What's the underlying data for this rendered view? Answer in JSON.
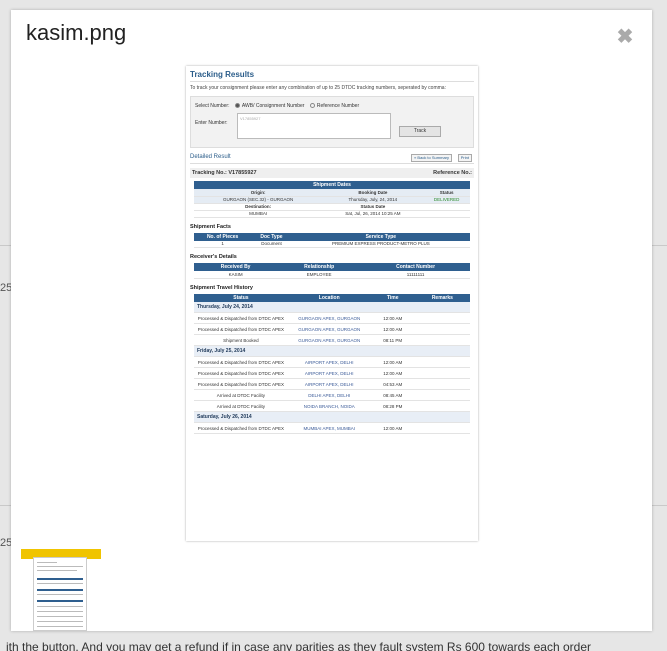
{
  "background": {
    "row_num_1": "25",
    "row_num_2": "25",
    "bottom_text": "ith the button. And you may get a refund if in case any parities as they fault system Rs 600 towards each order"
  },
  "lightbox": {
    "title": "kasim.png",
    "close_glyph": "✖"
  },
  "image": {
    "title": "Tracking Results",
    "description": "To track your consignment please enter any combination of up to 25 DTDC tracking numbers, seperated by comma:",
    "select_label": "Select Number:",
    "radio_awb": "AWB/ Consignment Number",
    "radio_ref": "Reference Number",
    "enter_label": "Enter Number:",
    "enter_value": "V17855927",
    "track_button": "Track",
    "detailed_result": "Detailed Result",
    "back_button": "« Back to Summary",
    "print_button": "Print",
    "tracking_no": "Tracking No.: V17855927",
    "reference_no": "Reference No.:",
    "shipment_dates_header": "Shipment Dates",
    "origin_label": "Origin:",
    "origin_value": "GURGAON (SEC.32) - GURGAON",
    "booking_label": "Booking Date",
    "booking_value": "Thursday, July, 24, 2014",
    "status_label": "Status",
    "status_value": "DELIVERED",
    "destination_label": "Destination:",
    "destination_value": "MUMBAI",
    "status_date_label": "Status Date",
    "status_date_value": "Sat, Jul, 26, 2014 10:25 AM",
    "facts_title": "Shipment Facts",
    "facts_headers": [
      "No. of Pieces",
      "Doc Type",
      "Service Type"
    ],
    "facts_row": [
      "1",
      "Document",
      "PREMIUM EXPRESS PRODUCT-METRO PLUS"
    ],
    "receiver_title": "Receiver's Details",
    "receiver_headers": [
      "Received By",
      "Relationship",
      "Contact Number"
    ],
    "receiver_row": [
      "KASIM",
      "EMPLOYEE",
      "11111111"
    ],
    "history_title": "Shipment Travel History",
    "history_headers": [
      "Status",
      "Location",
      "Time",
      "Remarks"
    ],
    "day1": "Thursday, July 24, 2014",
    "day1_rows": [
      [
        "Processed & Dispatched from DTDC APEX",
        "GURGAON APEX, GURGAON",
        "12:00 AM"
      ],
      [
        "Processed & Dispatched from DTDC APEX",
        "GURGAON APEX, GURGAON",
        "12:00 AM"
      ],
      [
        "Shipment Booked",
        "GURGAON APEX, GURGAON",
        "08:11 PM"
      ]
    ],
    "day2": "Friday, July 25, 2014",
    "day2_rows": [
      [
        "Processed & Dispatched from DTDC APEX",
        "AIRPORT APEX, DELHI",
        "12:00 AM"
      ],
      [
        "Processed & Dispatched from DTDC APEX",
        "AIRPORT APEX, DELHI",
        "12:00 AM"
      ],
      [
        "Processed & Dispatched from DTDC APEX",
        "AIRPORT APEX, DELHI",
        "04:53 AM"
      ],
      [
        "Arrived at DTDC Facility",
        "DELHI APEX, DELHI",
        "08:45 AM"
      ],
      [
        "Arrived at DTDC Facility",
        "NOIDA BRANCH, NOIDA",
        "08:28 PM"
      ]
    ],
    "day3": "Saturday, July 26, 2014",
    "day3_rows": [
      [
        "Processed & Dispatched from DTDC APEX",
        "MUMBAI APEX, MUMBAI",
        "12:00 AM"
      ]
    ]
  },
  "colors": {
    "header_blue": "#2f5f8f",
    "thumb_bar": "#f0c400",
    "delivered_green": "#2b8a2b"
  }
}
